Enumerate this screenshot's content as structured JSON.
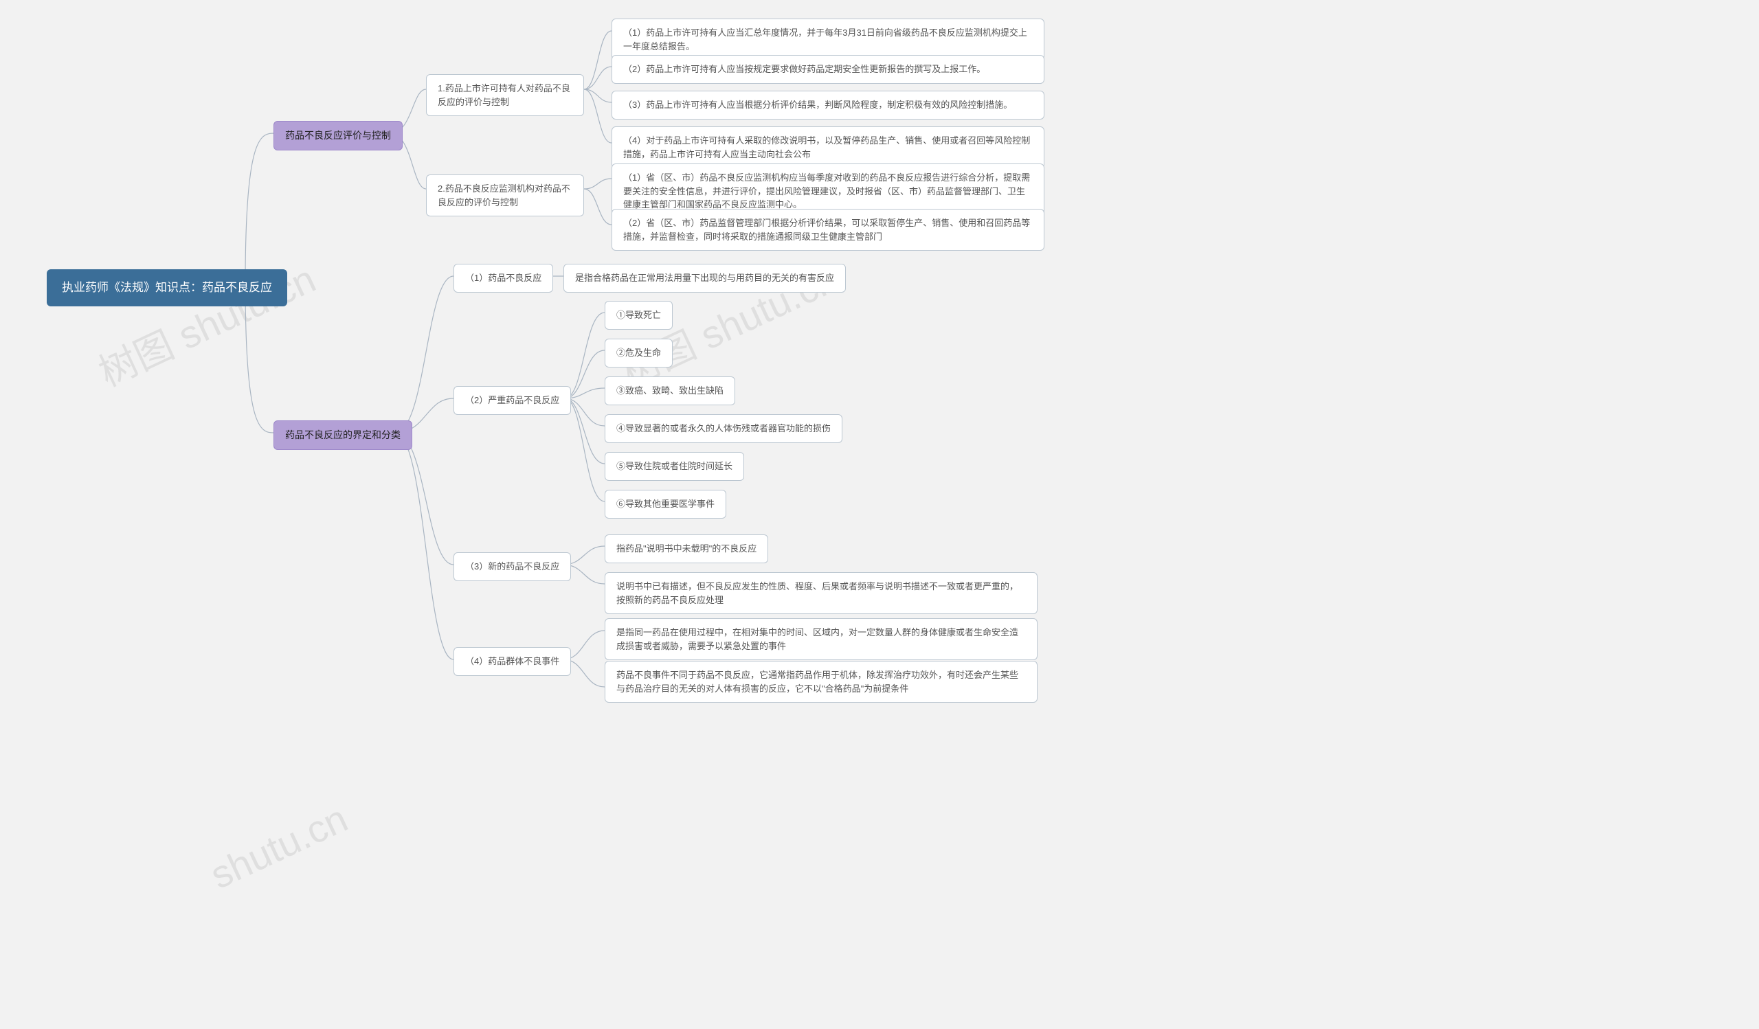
{
  "watermarks": [
    "树图 shutu.cn",
    "树图 shutu.cn",
    "shutu.cn"
  ],
  "root": "执业药师《法规》知识点：药品不良反应",
  "b1": "药品不良反应评价与控制",
  "b2": "药品不良反应的界定和分类",
  "b1_1": "1.药品上市许可持有人对药品不良反应的评价与控制",
  "b1_2": "2.药品不良反应监测机构对药品不良反应的评价与控制",
  "b1_1_1": "（1）药品上市许可持有人应当汇总年度情况，并于每年3月31日前向省级药品不良反应监测机构提交上一年度总结报告。",
  "b1_1_2": "（2）药品上市许可持有人应当按规定要求做好药品定期安全性更新报告的撰写及上报工作。",
  "b1_1_3": "（3）药品上市许可持有人应当根据分析评价结果，判断风险程度，制定积极有效的风险控制措施。",
  "b1_1_4": "（4）对于药品上市许可持有人采取的修改说明书，以及暂停药品生产、销售、使用或者召回等风险控制措施，药品上市许可持有人应当主动向社会公布",
  "b1_2_1": "（1）省（区、市）药品不良反应监测机构应当每季度对收到的药品不良反应报告进行综合分析，提取需要关注的安全性信息，并进行评价，提出风险管理建议，及时报省（区、市）药品监督管理部门、卫生健康主管部门和国家药品不良反应监测中心。",
  "b1_2_2": "（2）省（区、市）药品监督管理部门根据分析评价结果，可以采取暂停生产、销售、使用和召回药品等措施，并监督检查，同时将采取的措施通报同级卫生健康主管部门",
  "b2_1": "（1）药品不良反应",
  "b2_1_d": "是指合格药品在正常用法用量下出现的与用药目的无关的有害反应",
  "b2_2": "（2）严重药品不良反应",
  "b2_2_1": "①导致死亡",
  "b2_2_2": "②危及生命",
  "b2_2_3": "③致癌、致畸、致出生缺陷",
  "b2_2_4": "④导致显著的或者永久的人体伤残或者器官功能的损伤",
  "b2_2_5": "⑤导致住院或者住院时间延长",
  "b2_2_6": "⑥导致其他重要医学事件",
  "b2_3": "（3）新的药品不良反应",
  "b2_3_1": "指药品\"说明书中未载明\"的不良反应",
  "b2_3_2": "说明书中已有描述，但不良反应发生的性质、程度、后果或者频率与说明书描述不一致或者更严重的，按照新的药品不良反应处理",
  "b2_4": "（4）药品群体不良事件",
  "b2_4_1": "是指同一药品在使用过程中，在相对集中的时间、区域内，对一定数量人群的身体健康或者生命安全造成损害或者威胁，需要予以紧急处置的事件",
  "b2_4_2": "药品不良事件不同于药品不良反应，它通常指药品作用于机体，除发挥治疗功效外，有时还会产生某些与药品治疗目的无关的对人体有损害的反应，它不以\"合格药品\"为前提条件"
}
